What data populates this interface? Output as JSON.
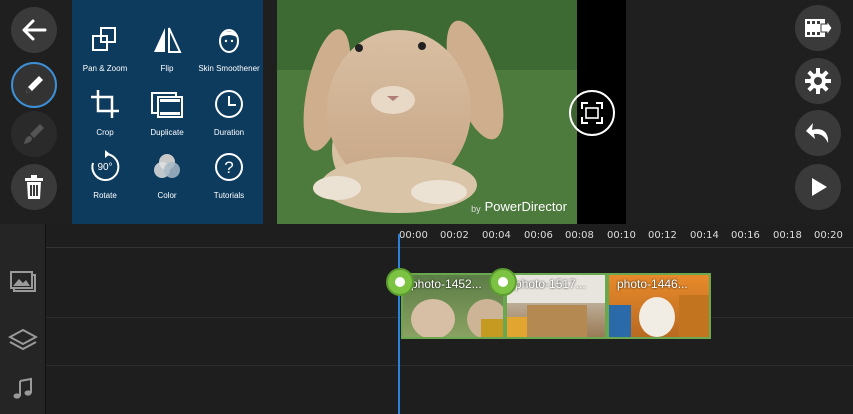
{
  "tools": {
    "pan_zoom": "Pan & Zoom",
    "flip": "Flip",
    "skin_smoothener": "Skin Smoothener",
    "crop": "Crop",
    "duplicate": "Duplicate",
    "duration": "Duration",
    "rotate": "Rotate",
    "rotate_badge": "90°",
    "color": "Color",
    "tutorials": "Tutorials"
  },
  "preview": {
    "watermark_by": "by",
    "watermark_brand": "PowerDirector"
  },
  "timeline": {
    "ticks": [
      "00:00",
      "00:02",
      "00:04",
      "00:06",
      "00:08",
      "00:10",
      "00:12",
      "00:14",
      "00:16",
      "00:18",
      "00:20"
    ],
    "clips": [
      {
        "name": "photo-1452..."
      },
      {
        "name": "photo-1517..."
      },
      {
        "name": "photo-1446..."
      }
    ]
  },
  "colors": {
    "panel_bg": "#0d3b5e",
    "accent_blue": "#2a83d8",
    "clip_border": "#6aa84f",
    "handle_green": "#7cc243"
  },
  "icons": [
    "back-arrow-icon",
    "pencil-icon",
    "brush-icon",
    "trash-icon",
    "export-video-icon",
    "settings-gear-icon",
    "undo-icon",
    "play-icon",
    "media-track-icon",
    "layers-icon",
    "music-note-icon"
  ]
}
